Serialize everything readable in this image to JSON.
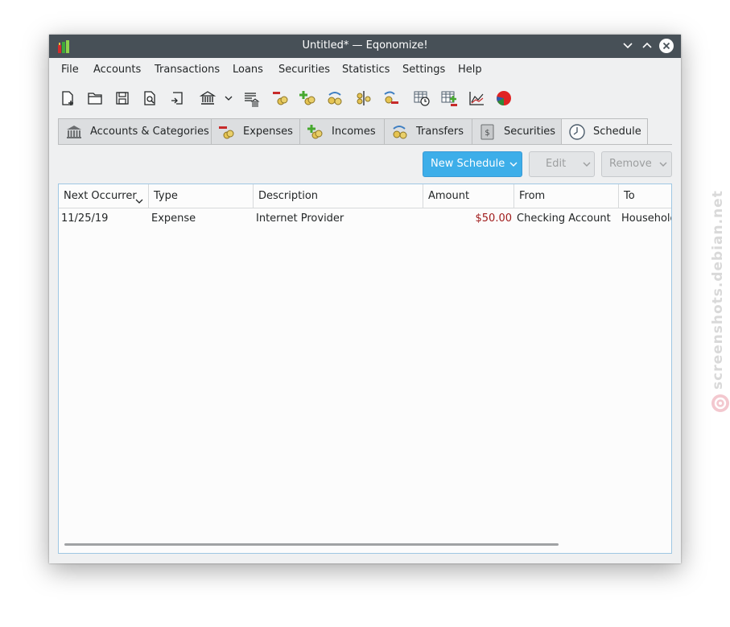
{
  "window": {
    "title": "Untitled* — Eqonomize!"
  },
  "menubar": {
    "items": [
      "File",
      "Accounts",
      "Transactions",
      "Loans",
      "Securities",
      "Statistics",
      "Settings",
      "Help"
    ]
  },
  "toolbar": {
    "icons": [
      "new-file-icon",
      "open-folder-icon",
      "save-icon",
      "print-preview-icon",
      "import-icon",
      "bank-icon",
      "dropdown-arrow-icon",
      "ledger-icon",
      "new-expense-icon",
      "new-income-icon",
      "new-transfer-icon",
      "split-transaction-icon",
      "new-refund-icon",
      "schedule-table-icon",
      "new-table-row-icon",
      "line-chart-icon",
      "pie-chart-icon"
    ]
  },
  "tabs": [
    {
      "label": "Accounts & Categories",
      "icon": "bank-icon",
      "active": false
    },
    {
      "label": "Expenses",
      "icon": "expense-coins-icon",
      "active": false
    },
    {
      "label": "Incomes",
      "icon": "income-coins-icon",
      "active": false
    },
    {
      "label": "Transfers",
      "icon": "transfer-coins-icon",
      "active": false
    },
    {
      "label": "Securities",
      "icon": "securities-icon",
      "active": false
    },
    {
      "label": "Schedule",
      "icon": "clock-icon",
      "active": true
    }
  ],
  "actions": {
    "new_schedule": "New Schedule",
    "edit": "Edit",
    "remove": "Remove"
  },
  "table": {
    "columns": [
      "Next Occurrer",
      "Type",
      "Description",
      "Amount",
      "From",
      "To"
    ],
    "rows": [
      {
        "next_occurrence": "11/25/19",
        "type": "Expense",
        "description": "Internet Provider",
        "amount": "$50.00",
        "from": "Checking Account",
        "to": "Household"
      }
    ]
  },
  "watermark": {
    "text": "screenshots.debian.net"
  },
  "colors": {
    "titlebar": "#475057",
    "accent": "#3daee9",
    "amount_negative": "#a01c1c"
  }
}
